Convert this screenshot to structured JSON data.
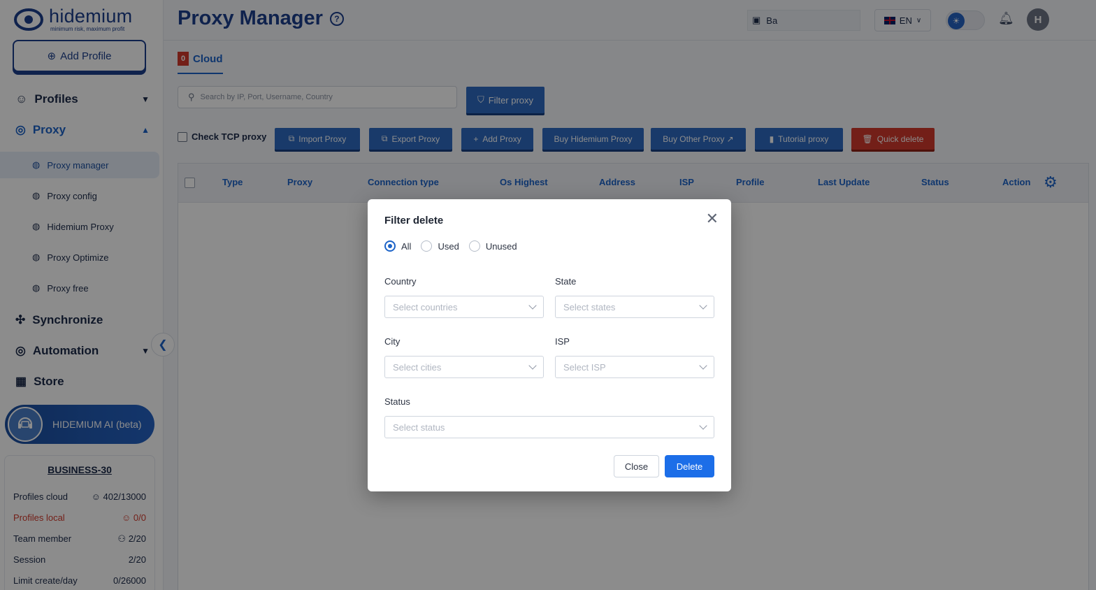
{
  "app": {
    "name": "hidemium",
    "tagline": "minimum risk, maximum profit"
  },
  "sidebar": {
    "add_profile": "Add Profile",
    "nav": {
      "profiles": "Profiles",
      "proxy": "Proxy",
      "synchronize": "Synchronize",
      "automation": "Automation",
      "store": "Store"
    },
    "proxy_items": [
      "Proxy manager",
      "Proxy config",
      "Hidemium Proxy",
      "Proxy Optimize",
      "Proxy free"
    ],
    "ai_button": "HIDEMIUM AI (beta)",
    "plan": {
      "name": "BUSINESS-30",
      "rows": [
        {
          "label": "Profiles cloud",
          "value": "402/13000"
        },
        {
          "label": "Profiles local",
          "value": "0/0"
        },
        {
          "label": "Team member",
          "value": "2/20"
        },
        {
          "label": "Session",
          "value": "2/20"
        },
        {
          "label": "Limit create/day",
          "value": "0/26000"
        }
      ]
    }
  },
  "header": {
    "title": "Proxy Manager",
    "balance": "Ba",
    "language": "EN",
    "avatar_initial": "H"
  },
  "tabs": [
    {
      "label": "Cloud",
      "count": "0"
    }
  ],
  "search": {
    "placeholder": "Search by IP, Port, Username, Country"
  },
  "filter_button": "Filter proxy",
  "toolbar": {
    "check_tcp": "Check TCP proxy",
    "buttons": [
      "Import Proxy",
      "Export Proxy",
      "Add Proxy",
      "Buy Hidemium Proxy",
      "Buy Other Proxy ↗",
      "Tutorial proxy",
      "Quick delete"
    ]
  },
  "table": {
    "columns": [
      "Type",
      "Proxy",
      "Connection type",
      "Os Highest",
      "Address",
      "ISP",
      "Profile",
      "Last Update",
      "Status",
      "Action"
    ]
  },
  "modal": {
    "title": "Filter delete",
    "radios": [
      "All",
      "Used",
      "Unused"
    ],
    "selected_radio": "All",
    "fields": {
      "country": {
        "label": "Country",
        "placeholder": "Select countries"
      },
      "state": {
        "label": "State",
        "placeholder": "Select states"
      },
      "city": {
        "label": "City",
        "placeholder": "Select cities"
      },
      "isp": {
        "label": "ISP",
        "placeholder": "Select ISP"
      },
      "status": {
        "label": "Status",
        "placeholder": "Select status"
      }
    },
    "close_label": "Close",
    "delete_label": "Delete"
  },
  "colors": {
    "primary": "#1c63c8",
    "danger": "#d23a2c",
    "brand": "#1c3f8c"
  }
}
